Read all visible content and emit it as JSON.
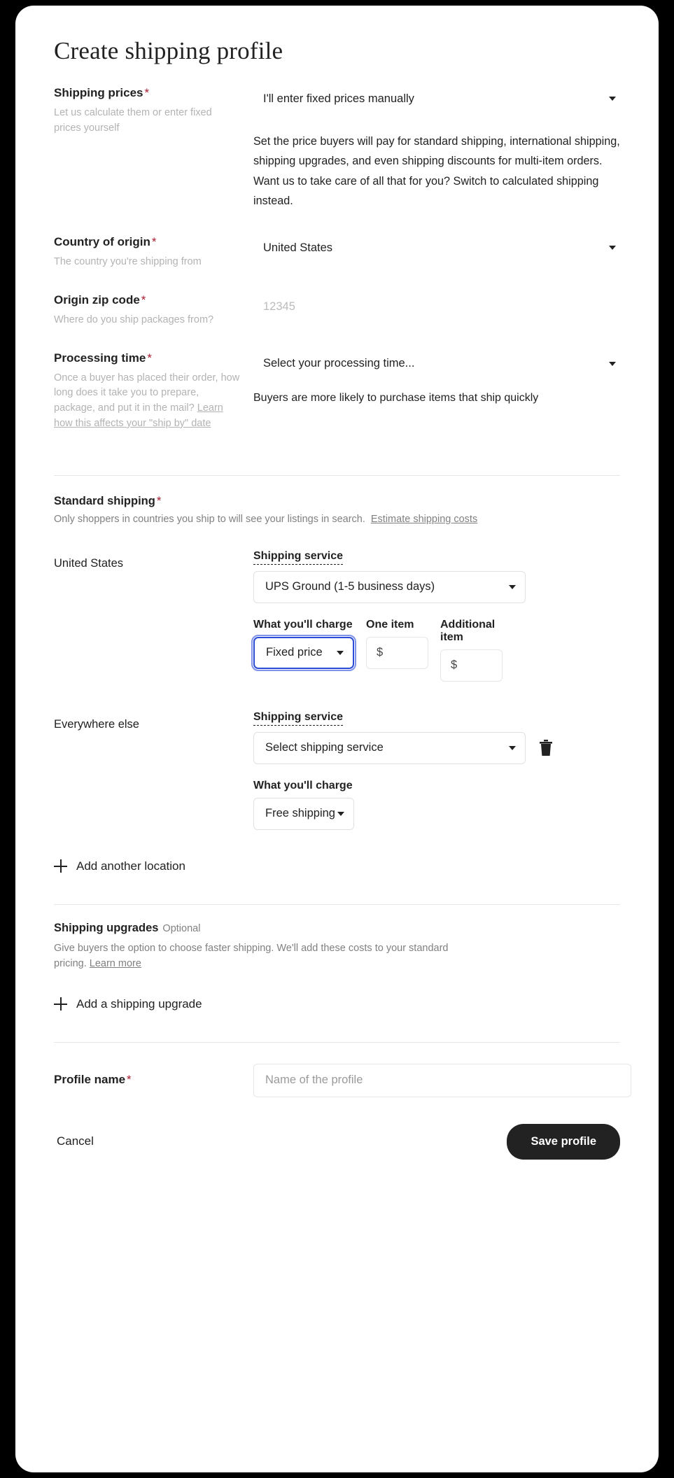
{
  "page": {
    "title": "Create shipping profile"
  },
  "shipping_prices": {
    "label": "Shipping prices",
    "required_mark": "*",
    "help": "Let us calculate them or enter fixed prices yourself",
    "selected_option": "I'll enter fixed prices manually",
    "description": "Set the price buyers will pay for standard shipping, international shipping, shipping upgrades, and even shipping discounts for multi-item orders. Want us to take care of all that for you? Switch to calculated shipping instead."
  },
  "country_of_origin": {
    "label": "Country of origin",
    "required_mark": "*",
    "help": "The country you're shipping from",
    "selected_option": "United States"
  },
  "origin_zip": {
    "label": "Origin zip code",
    "required_mark": "*",
    "help": "Where do you ship packages from?",
    "placeholder": "12345",
    "value": ""
  },
  "processing_time": {
    "label": "Processing time",
    "required_mark": "*",
    "help_text": "Once a buyer has placed their order, how long does it take you to prepare, package, and put it in the mail? ",
    "help_link": "Learn how this affects your \"ship by\" date",
    "selected_option": "Select your processing time...",
    "note": "Buyers are more likely to purchase items that ship quickly"
  },
  "standard_shipping": {
    "label": "Standard shipping",
    "required_mark": "*",
    "description": "Only shoppers in countries you ship to will see your listings in search.",
    "estimate_link": "Estimate shipping costs",
    "locations": [
      {
        "name": "United States",
        "service_label": "Shipping service",
        "service_value": "UPS Ground (1-5 business days)",
        "charge_label": "What you'll charge",
        "charge_value": "Fixed price",
        "one_item_label": "One item",
        "one_item_value": "$",
        "additional_item_label": "Additional item",
        "additional_item_value": "$",
        "has_delete": false,
        "focused": true
      },
      {
        "name": "Everywhere else",
        "service_label": "Shipping service",
        "service_value": "Select shipping service",
        "charge_label": "What you'll charge",
        "charge_value": "Free shipping",
        "has_delete": true,
        "focused": false
      }
    ],
    "add_location_label": "Add another location"
  },
  "shipping_upgrades": {
    "label": "Shipping upgrades",
    "optional_tag": "Optional",
    "description": "Give buyers the option to choose faster shipping. We'll add these costs to your standard pricing. ",
    "description_link": "Learn more",
    "add_upgrade_label": "Add a shipping upgrade"
  },
  "profile_name": {
    "label": "Profile name",
    "required_mark": "*",
    "placeholder": "Name of the profile",
    "value": ""
  },
  "actions": {
    "cancel_label": "Cancel",
    "save_label": "Save profile"
  },
  "colors": {
    "required_red": "#a61a2e",
    "focus_blue": "#2b4bd6",
    "text_dark": "#222222",
    "muted": "#b3b3b3"
  }
}
